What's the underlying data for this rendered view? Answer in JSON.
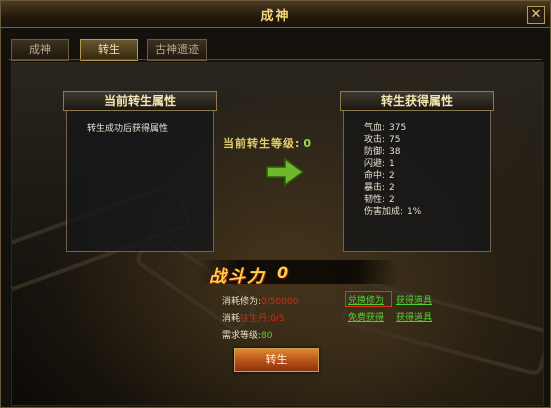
{
  "window": {
    "title": "成神"
  },
  "tabs": [
    {
      "label": "成神"
    },
    {
      "label": "转生",
      "active": true
    },
    {
      "label": "古神遗迹"
    }
  ],
  "current_panel": {
    "title": "当前转生属性",
    "text": "转生成功后获得属性"
  },
  "gain_panel": {
    "title": "转生获得属性",
    "stats": [
      {
        "label": "气血:",
        "value": "375"
      },
      {
        "label": "攻击:",
        "value": "75"
      },
      {
        "label": "防御:",
        "value": "38"
      },
      {
        "label": "闪避:",
        "value": "1"
      },
      {
        "label": "命中:",
        "value": "2"
      },
      {
        "label": "暴击:",
        "value": "2"
      },
      {
        "label": "韧性:",
        "value": "2"
      },
      {
        "label": "伤害加成:",
        "value": "1%"
      }
    ]
  },
  "level": {
    "label": "当前转生等级:",
    "value": "0"
  },
  "power": {
    "label": "战斗力",
    "value": "0"
  },
  "costs": {
    "cultivation": {
      "label": "消耗修为:",
      "value": "0/50000"
    },
    "dan": {
      "prefix": "消耗",
      "item": "往生丹",
      "value": ":0/5"
    },
    "level_req": {
      "label": "需求等级:",
      "value": "80"
    }
  },
  "links": {
    "exchange": "兑换修为",
    "get_item_1": "获得道具",
    "free_get": "免费获得",
    "get_item_2": "获得道具"
  },
  "action_button": "转生",
  "colors": {
    "accent": "#e5cd6a",
    "link": "#4fd32f",
    "warning": "#d52b1a",
    "level": "#9fdc4f"
  }
}
